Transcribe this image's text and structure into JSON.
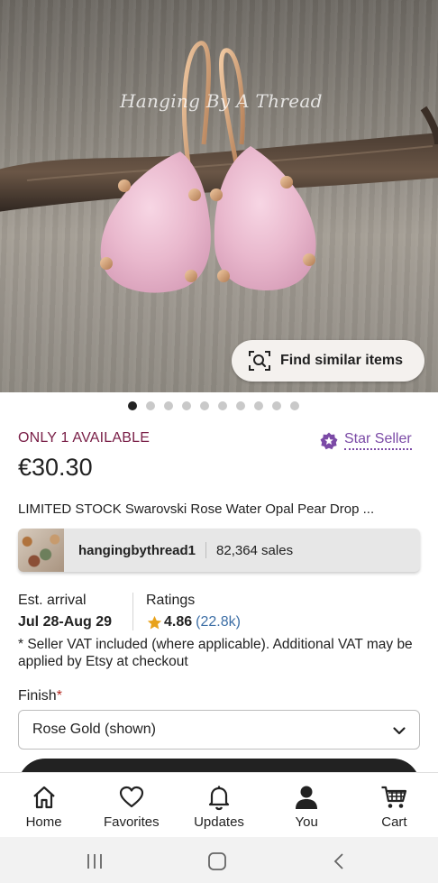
{
  "hero": {
    "watermark": "Hanging By A Thread",
    "find_similar_label": "Find similar items",
    "find_similar_icon": "visual-search-icon",
    "image_count": 10,
    "active_index": 0
  },
  "listing": {
    "availability": "ONLY 1 AVAILABLE",
    "star_seller_label": "Star Seller",
    "star_seller_icon": "star-badge-icon",
    "price": "€30.30",
    "title": "LIMITED STOCK Swarovski Rose Water Opal Pear Drop ..."
  },
  "shop": {
    "name": "hangingbythread1",
    "sales": "82,364 sales"
  },
  "delivery": {
    "est_label": "Est. arrival",
    "est_value": "Jul 28-Aug 29"
  },
  "ratings": {
    "label": "Ratings",
    "value": "4.86",
    "count": "(22.8k)"
  },
  "vat_note": "* Seller VAT included (where applicable). Additional VAT may be applied by Etsy at checkout",
  "finish": {
    "label": "Finish",
    "required_mark": "*",
    "selected": "Rose Gold (shown)"
  },
  "nav": {
    "items": [
      {
        "label": "Home",
        "icon": "home-icon"
      },
      {
        "label": "Favorites",
        "icon": "heart-icon"
      },
      {
        "label": "Updates",
        "icon": "bell-icon"
      },
      {
        "label": "You",
        "icon": "person-icon"
      },
      {
        "label": "Cart",
        "icon": "cart-icon"
      }
    ]
  },
  "colors": {
    "availability": "#7a2048",
    "star_seller": "#7b4aa6",
    "rating_count": "#3d6fa6",
    "star": "#e8a21b"
  }
}
